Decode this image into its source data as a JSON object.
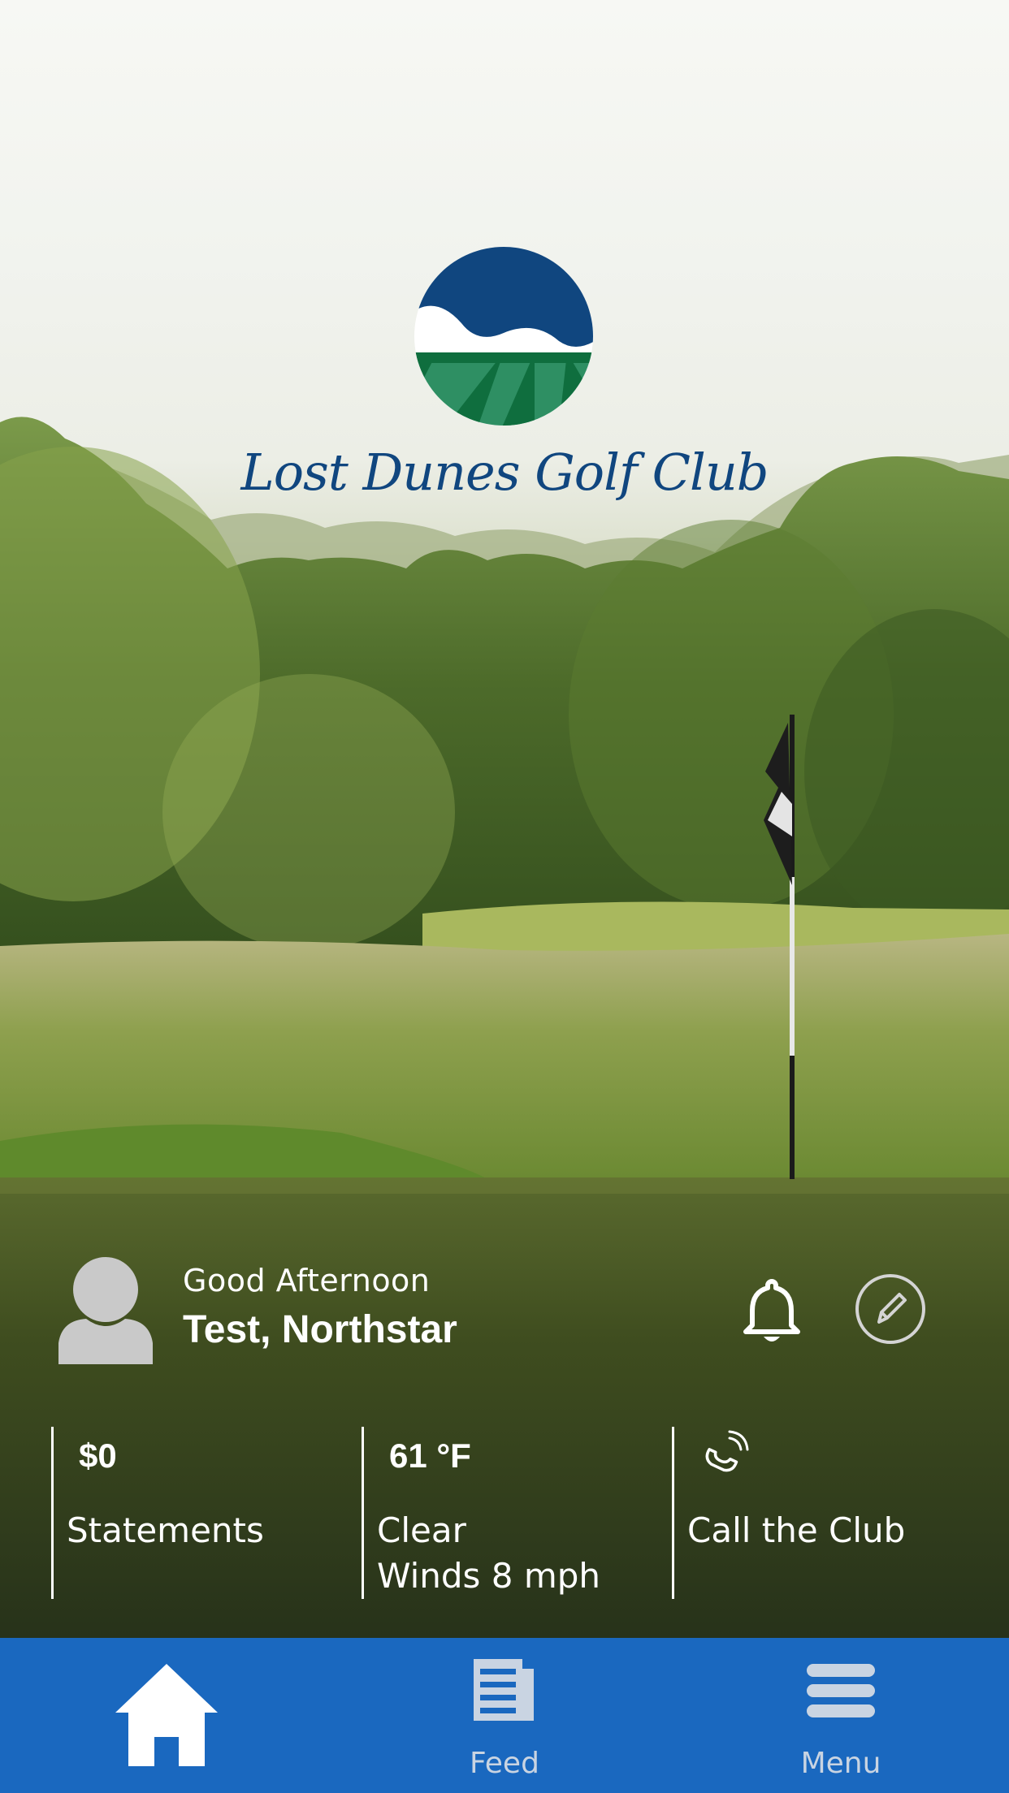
{
  "brand": {
    "name": "Lost Dunes Golf Club",
    "navy": "#10467f",
    "green": "#0f7a43"
  },
  "profile": {
    "greeting": "Good Afternoon",
    "name": "Test, Northstar",
    "avatar_icon": "person-silhouette-icon",
    "notifications_icon": "bell-icon",
    "edit_icon": "pencil-icon"
  },
  "tiles": [
    {
      "value": "$0",
      "label": "Statements"
    },
    {
      "value": "61 °F",
      "label_line1": "Clear",
      "label_line2": "Winds 8 mph"
    },
    {
      "icon": "phone-icon",
      "label": "Call the Club"
    }
  ],
  "nav": {
    "background": "#1a68bf",
    "items": [
      {
        "id": "home",
        "icon": "home-icon",
        "label": "",
        "active": true
      },
      {
        "id": "feed",
        "icon": "newspaper-icon",
        "label": "Feed",
        "active": false
      },
      {
        "id": "menu",
        "icon": "hamburger-icon",
        "label": "Menu",
        "active": false
      }
    ]
  }
}
